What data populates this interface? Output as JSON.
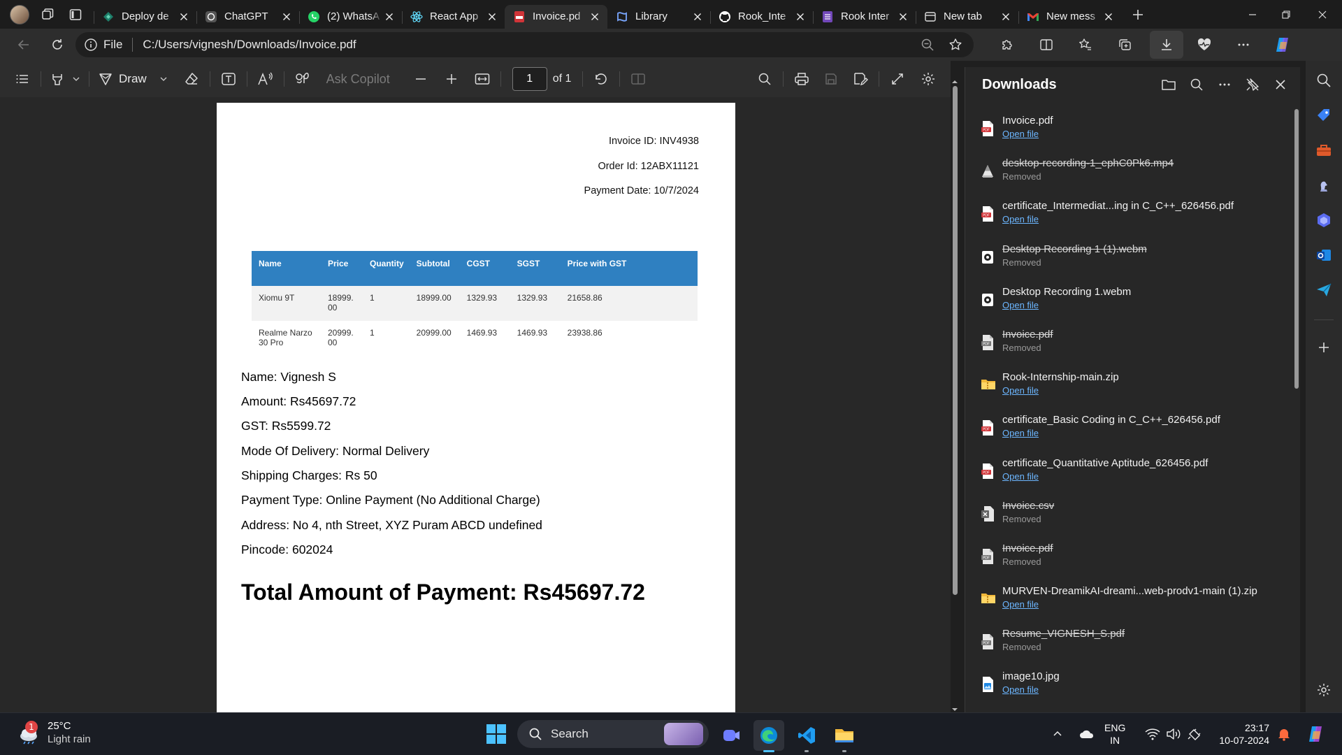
{
  "tabs": [
    {
      "title": "Deploy de",
      "icon": "deploy-icon",
      "active": false
    },
    {
      "title": "ChatGPT",
      "icon": "chatgpt-icon",
      "active": false
    },
    {
      "title": "(2) WhatsA",
      "icon": "whatsapp-icon",
      "active": false
    },
    {
      "title": "React App",
      "icon": "react-icon",
      "active": false
    },
    {
      "title": "Invoice.pd",
      "icon": "pdf-icon",
      "active": true
    },
    {
      "title": "Library",
      "icon": "library-icon",
      "active": false
    },
    {
      "title": "Rook_Inte",
      "icon": "github-icon",
      "active": false
    },
    {
      "title": "Rook Inter",
      "icon": "form-icon",
      "active": false
    },
    {
      "title": "New tab",
      "icon": "newtab-icon",
      "active": false
    },
    {
      "title": "New mess",
      "icon": "gmail-icon",
      "active": false
    }
  ],
  "address": {
    "scheme": "File",
    "path": "C:/Users/vignesh/Downloads/Invoice.pdf"
  },
  "pdf_toolbar": {
    "draw_label": "Draw",
    "copilot_label": "Ask Copilot",
    "page_current": "1",
    "page_total": "of 1"
  },
  "invoice": {
    "invoice_id": "Invoice ID: INV4938",
    "order_id": "Order Id: 12ABX11121",
    "payment_date": "Payment Date: 10/7/2024",
    "table": {
      "headers": [
        "Name",
        "Price",
        "Quantity",
        "Subtotal",
        "CGST",
        "SGST",
        "Price with GST"
      ],
      "rows": [
        [
          "Xiomu 9T",
          "18999.00",
          "1",
          "18999.00",
          "1329.93",
          "1329.93",
          "21658.86"
        ],
        [
          "Realme Narzo 30 Pro",
          "20999.00",
          "1",
          "20999.00",
          "1469.93",
          "1469.93",
          "23938.86"
        ]
      ]
    },
    "name": "Name: Vignesh S",
    "amount": "Amount: Rs45697.72",
    "gst": "GST: Rs5599.72",
    "delivery": "Mode Of Delivery: Normal Delivery",
    "shipping": "Shipping Charges: Rs 50",
    "payment_type": "Payment Type: Online Payment (No Additional Charge)",
    "address": "Address: No 4, nth Street, XYZ Puram ABCD undefined",
    "pincode": "Pincode: 602024",
    "total": "Total Amount of Payment: Rs45697.72"
  },
  "downloads": {
    "title": "Downloads",
    "items": [
      {
        "name": "Invoice.pdf",
        "status": "Open file",
        "removed": false,
        "icon": "pdf-file-icon"
      },
      {
        "name": "desktop-recording-1_ephC0Pk6.mp4",
        "status": "Removed",
        "removed": true,
        "icon": "video-file-icon"
      },
      {
        "name": "certificate_Intermediat...ing in C_C++_626456.pdf",
        "status": "Open file",
        "removed": false,
        "icon": "pdf-file-icon"
      },
      {
        "name": "Desktop Recording 1 (1).webm",
        "status": "Removed",
        "removed": true,
        "icon": "media-file-icon"
      },
      {
        "name": "Desktop Recording 1.webm",
        "status": "Open file",
        "removed": false,
        "icon": "media-file-icon"
      },
      {
        "name": "Invoice.pdf",
        "status": "Removed",
        "removed": true,
        "icon": "pdf-file-gray-icon"
      },
      {
        "name": "Rook-Internship-main.zip",
        "status": "Open file",
        "removed": false,
        "icon": "zip-folder-icon"
      },
      {
        "name": "certificate_Basic Coding in C_C++_626456.pdf",
        "status": "Open file",
        "removed": false,
        "icon": "pdf-file-icon"
      },
      {
        "name": "certificate_Quantitative Aptitude_626456.pdf",
        "status": "Open file",
        "removed": false,
        "icon": "pdf-file-icon"
      },
      {
        "name": "Invoice.csv",
        "status": "Removed",
        "removed": true,
        "icon": "excel-file-icon"
      },
      {
        "name": "Invoice.pdf",
        "status": "Removed",
        "removed": true,
        "icon": "pdf-file-gray-icon"
      },
      {
        "name": "MURVEN-DreamikAI-dreami...web-prodv1-main (1).zip",
        "status": "Open file",
        "removed": false,
        "icon": "zip-folder-icon"
      },
      {
        "name": "Resume_VIGNESH_S.pdf",
        "status": "Removed",
        "removed": true,
        "icon": "pdf-file-gray-icon"
      },
      {
        "name": "image10.jpg",
        "status": "Open file",
        "removed": false,
        "icon": "image-file-icon"
      }
    ]
  },
  "taskbar": {
    "weather_badge": "1",
    "temperature": "25°C",
    "condition": "Light rain",
    "search_label": "Search",
    "lang_top": "ENG",
    "lang_bottom": "IN",
    "time": "23:17",
    "date": "10-07-2024"
  },
  "colors": {
    "table_header": "#2f80c1",
    "link": "#6cb6ff",
    "accent": "#4cc2ff",
    "pdf_red": "#d13438"
  }
}
